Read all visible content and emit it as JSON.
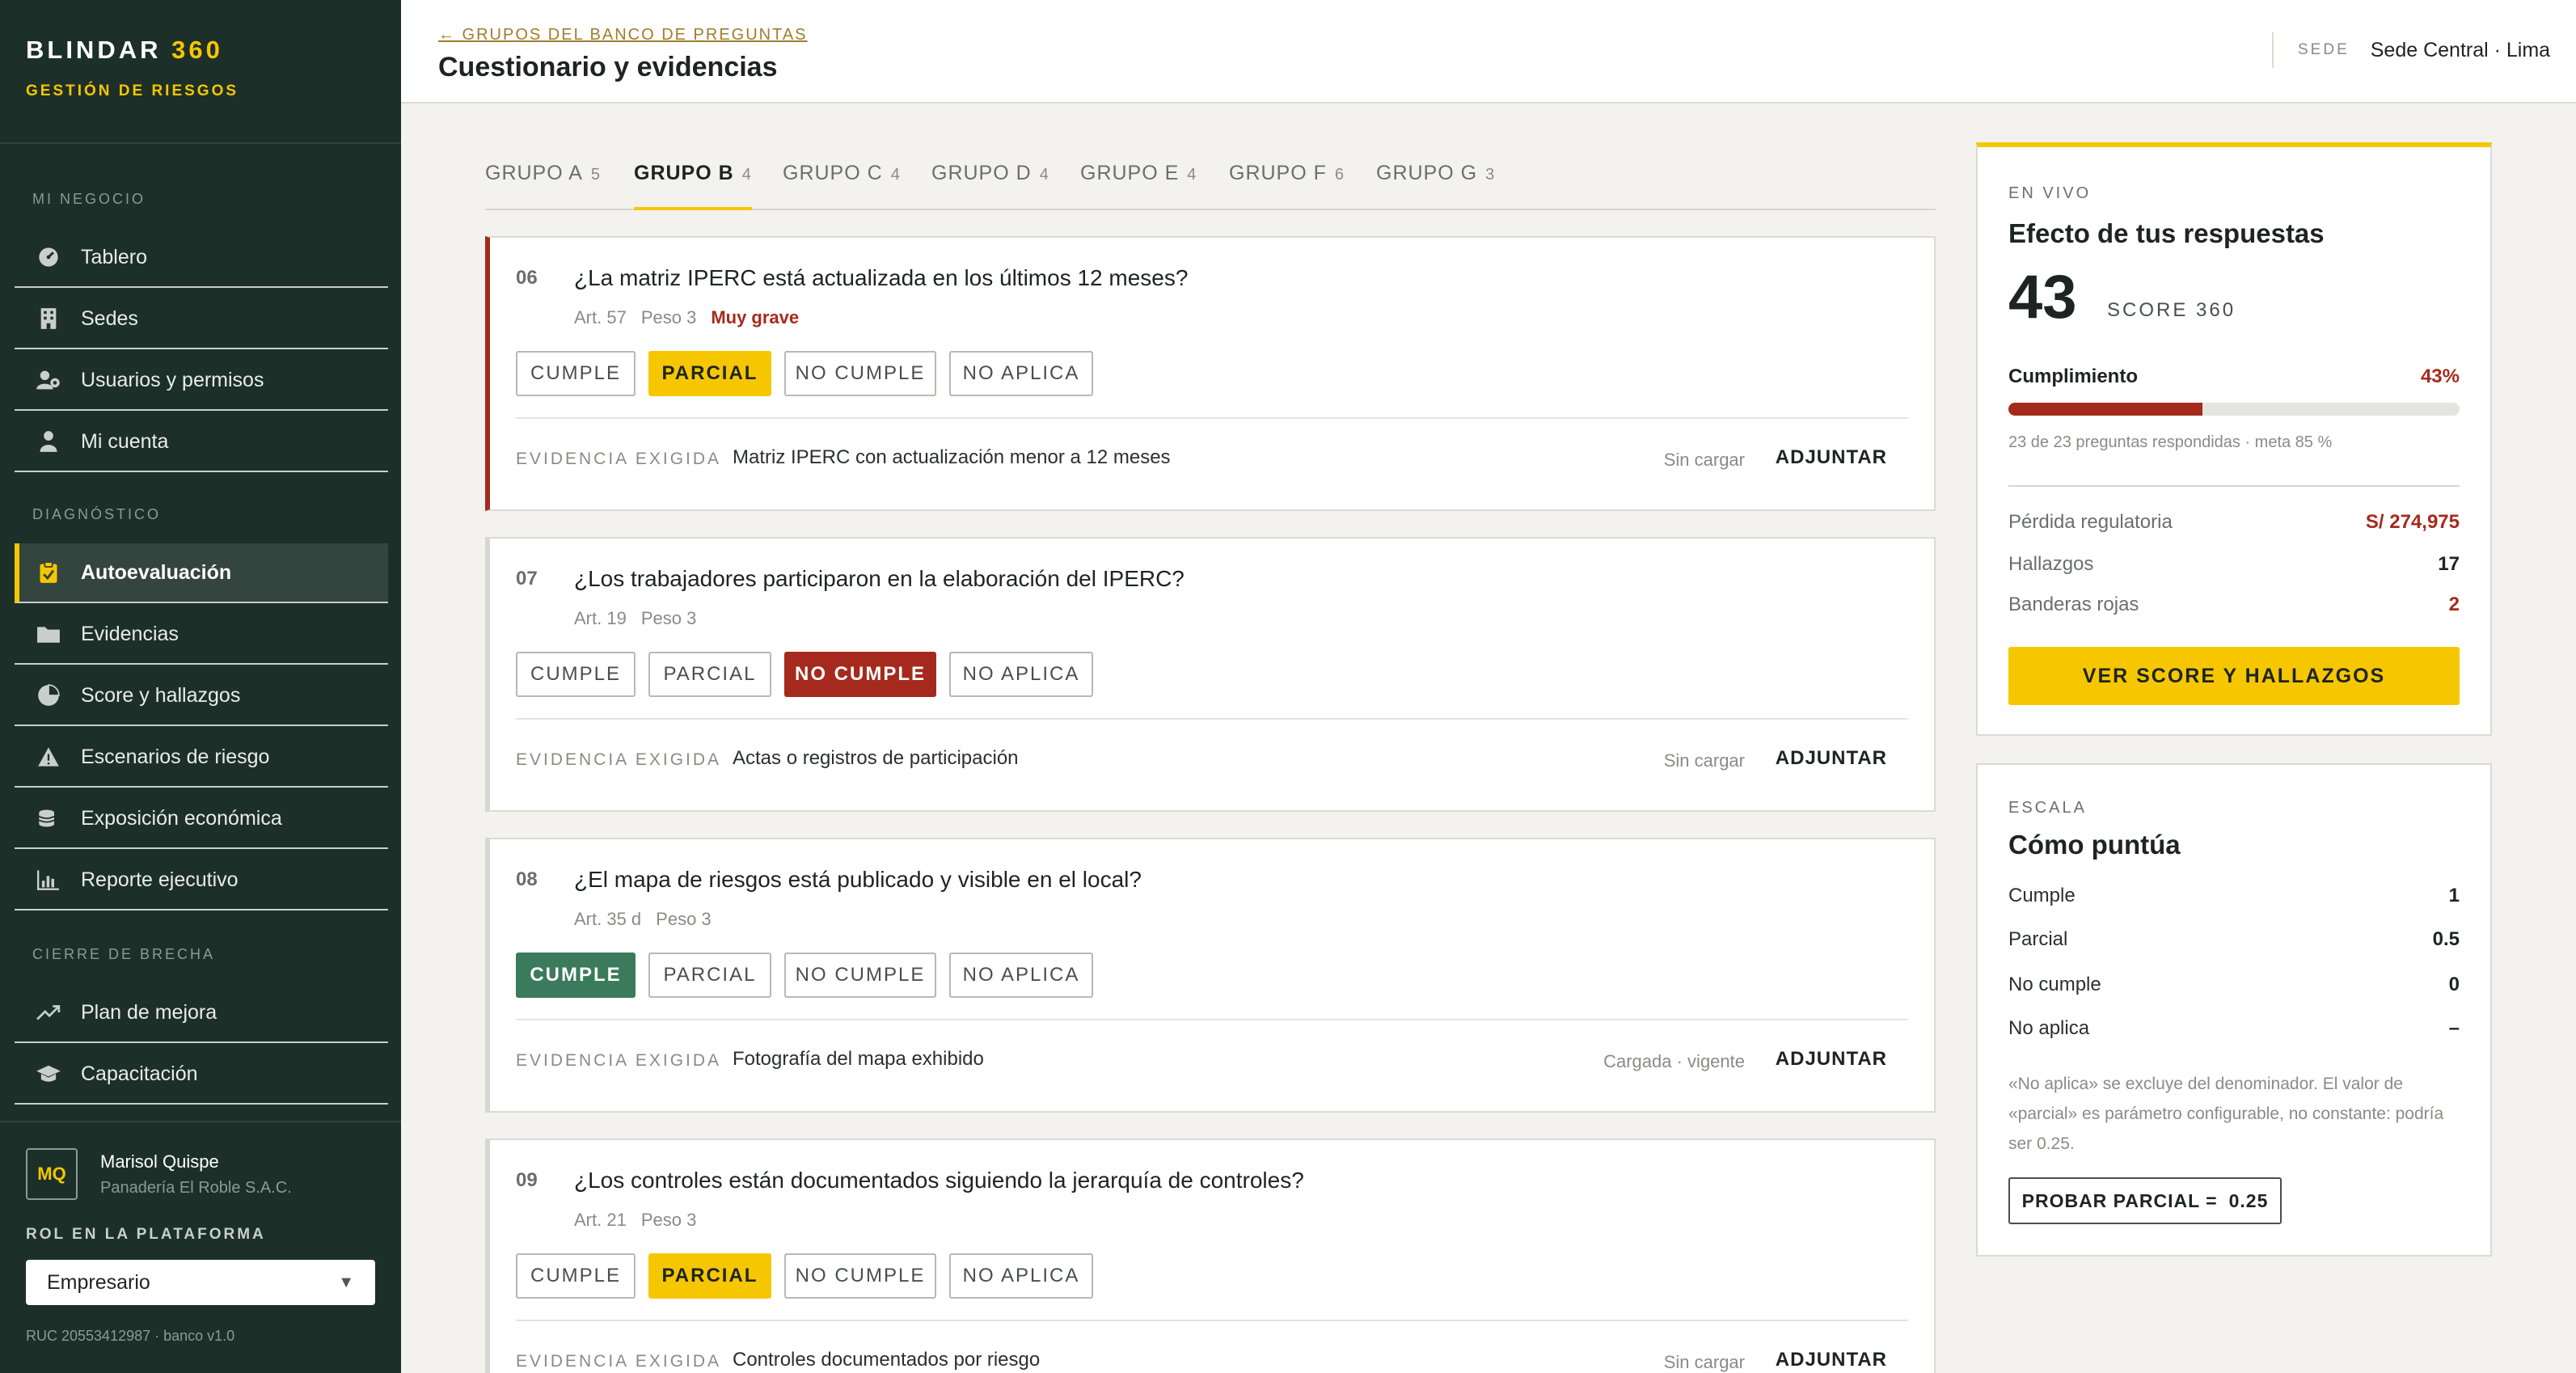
{
  "brand": {
    "name": "BLINDAR",
    "num": "360",
    "subtitle": "GESTIÓN DE RIESGOS"
  },
  "sidebar": {
    "sections": [
      "MI NEGOCIO",
      "DIAGNÓSTICO",
      "CIERRE DE BRECHA"
    ],
    "items": [
      {
        "label": "Tablero",
        "icon": "dashboard-icon"
      },
      {
        "label": "Sedes",
        "icon": "building-icon"
      },
      {
        "label": "Usuarios y permisos",
        "icon": "users-icon"
      },
      {
        "label": "Mi cuenta",
        "icon": "user-icon"
      },
      {
        "label": "Autoevaluación",
        "icon": "clipboard-icon"
      },
      {
        "label": "Evidencias",
        "icon": "folder-icon"
      },
      {
        "label": "Score y hallazgos",
        "icon": "pie-icon"
      },
      {
        "label": "Escenarios de riesgo",
        "icon": "warning-icon"
      },
      {
        "label": "Exposición económica",
        "icon": "coins-icon"
      },
      {
        "label": "Reporte ejecutivo",
        "icon": "bar-chart-icon"
      },
      {
        "label": "Plan de mejora",
        "icon": "trend-icon"
      },
      {
        "label": "Capacitación",
        "icon": "graduation-icon"
      }
    ],
    "active_item": "Autoevaluación"
  },
  "user": {
    "initials": "MQ",
    "name": "Marisol Quispe",
    "company": "Panadería El Roble S.A.C.",
    "role_label": "ROL EN LA PLATAFORMA",
    "role": "Empresario",
    "footer": "RUC 20553412987 · banco v1.0"
  },
  "header": {
    "breadcrumb": "← GRUPOS DEL BANCO DE PREGUNTAS",
    "title": "Cuestionario y evidencias",
    "sede_label": "SEDE",
    "sede_value": "Sede Central · Lima"
  },
  "tabs": [
    {
      "label": "GRUPO A",
      "count": "5"
    },
    {
      "label": "GRUPO B",
      "count": "4"
    },
    {
      "label": "GRUPO C",
      "count": "4"
    },
    {
      "label": "GRUPO D",
      "count": "4"
    },
    {
      "label": "GRUPO E",
      "count": "4"
    },
    {
      "label": "GRUPO F",
      "count": "6"
    },
    {
      "label": "GRUPO G",
      "count": "3"
    }
  ],
  "active_tab": "GRUPO B",
  "answer_options": [
    "CUMPLE",
    "PARCIAL",
    "NO CUMPLE",
    "NO APLICA"
  ],
  "evidence_label": "EVIDENCIA EXIGIDA",
  "attach_label": "ADJUNTAR",
  "questions": [
    {
      "num": "06",
      "text": "¿La matriz IPERC está actualizada en los últimos 12 meses?",
      "art": "Art. 57",
      "peso": "Peso 3",
      "severity": "Muy grave",
      "answer": "PARCIAL",
      "evidence": "Matriz IPERC con actualización menor a 12 meses",
      "status": "Sin cargar"
    },
    {
      "num": "07",
      "text": "¿Los trabajadores participaron en la elaboración del IPERC?",
      "art": "Art. 19",
      "peso": "Peso 3",
      "severity": "",
      "answer": "NO CUMPLE",
      "evidence": "Actas o registros de participación",
      "status": "Sin cargar"
    },
    {
      "num": "08",
      "text": "¿El mapa de riesgos está publicado y visible en el local?",
      "art": "Art. 35 d",
      "peso": "Peso 3",
      "severity": "",
      "answer": "CUMPLE",
      "evidence": "Fotografía del mapa exhibido",
      "status": "Cargada · vigente"
    },
    {
      "num": "09",
      "text": "¿Los controles están documentados siguiendo la jerarquía de controles?",
      "art": "Art. 21",
      "peso": "Peso 3",
      "severity": "",
      "answer": "PARCIAL",
      "evidence": "Controles documentados por riesgo",
      "status": "Sin cargar"
    }
  ],
  "live": {
    "label": "EN VIVO",
    "title": "Efecto de tus respuestas",
    "score": "43",
    "score_label": "SCORE 360",
    "compliance_label": "Cumplimiento",
    "compliance_value": "43%",
    "compliance_fraction": 0.43,
    "progress_note": "23 de 23 preguntas respondidas · meta 85 %",
    "metrics": [
      {
        "label": "Pérdida regulatoria",
        "value": "S/ 274,975"
      },
      {
        "label": "Hallazgos",
        "value": "17"
      },
      {
        "label": "Banderas rojas",
        "value": "2"
      }
    ],
    "cta": "VER SCORE Y HALLAZGOS"
  },
  "scale": {
    "label": "ESCALA",
    "title": "Cómo puntúa",
    "rows": [
      {
        "label": "Cumple",
        "value": "1"
      },
      {
        "label": "Parcial",
        "value": "0.5"
      },
      {
        "label": "No cumple",
        "value": "0"
      },
      {
        "label": "No aplica",
        "value": "–"
      }
    ],
    "note": "«No aplica» se excluye del denominador. El valor de «parcial» es parámetro configurable, no constante: podría ser 0.25.",
    "button_label": "PROBAR PARCIAL =",
    "button_value": "0.25"
  },
  "colors": {
    "accent": "#f6c700",
    "sidebar": "#1d2f29",
    "danger": "#a52a1d",
    "success": "#3b7a5a"
  }
}
